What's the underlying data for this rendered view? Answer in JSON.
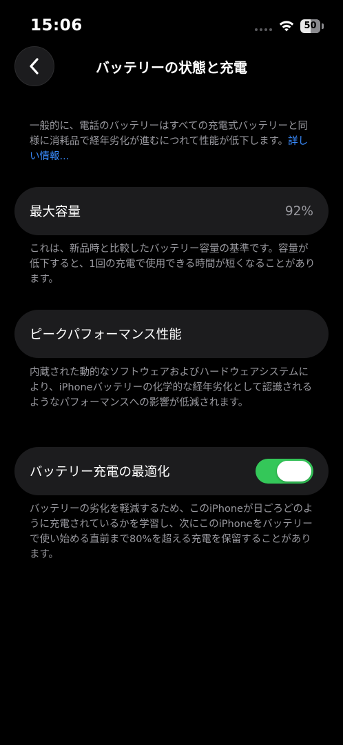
{
  "status_bar": {
    "time": "15:06",
    "battery_level": "50"
  },
  "header": {
    "title": "バッテリーの状態と充電"
  },
  "intro": {
    "text": "一般的に、電話のバッテリーはすべての充電式バッテリーと同様に消耗品で経年劣化が進むにつれて性能が低下します。",
    "link": "詳しい情報..."
  },
  "max_capacity": {
    "label": "最大容量",
    "value": "92%",
    "description": "これは、新品時と比較したバッテリー容量の基準です。容量が低下すると、1回の充電で使用できる時間が短くなることがあります。"
  },
  "peak_performance": {
    "label": "ピークパフォーマンス性能",
    "description": "内蔵された動的なソフトウェアおよびハードウェアシステムにより、iPhoneバッテリーの化学的な経年劣化として認識されるようなパフォーマンスへの影響が低減されます。"
  },
  "optimized_charging": {
    "label": "バッテリー充電の最適化",
    "enabled": true,
    "description": "バッテリーの劣化を軽減するため、このiPhoneが日ごろどのように充電されているかを学習し、次にこのiPhoneをバッテリーで使い始める直前まで80%を超える充電を保留することがあります。"
  },
  "colors": {
    "background": "#000000",
    "card": "#1c1c1e",
    "secondary_text": "#98989e",
    "link": "#3a8cff",
    "toggle_on": "#34c759"
  },
  "icons": [
    "back-chevron-icon",
    "wifi-icon",
    "battery-icon",
    "cellular-signal-icon"
  ]
}
